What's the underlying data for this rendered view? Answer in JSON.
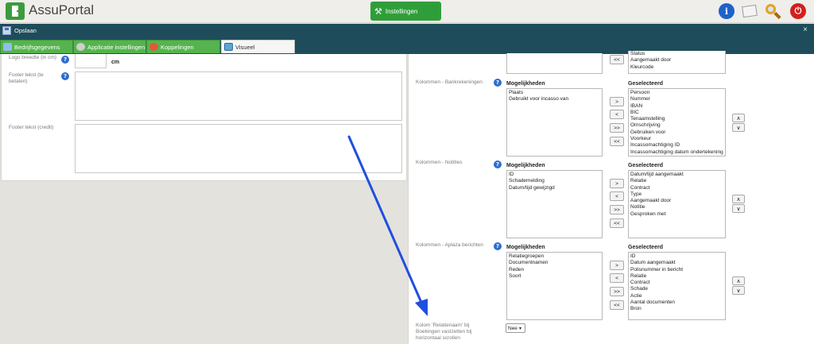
{
  "app": {
    "name": "AssuPortal"
  },
  "header": {
    "settings_label": "Instellingen",
    "info_icon": "info-icon",
    "messages_icon": "envelope-icon",
    "search_icon": "magnifier-icon",
    "power_icon": "power-icon"
  },
  "savebar": {
    "save_label": "Opslaan",
    "close": "×"
  },
  "tabs": [
    {
      "label": "Bedrijfsgegevens",
      "active": false
    },
    {
      "label": "Applicatie instellingen",
      "active": false
    },
    {
      "label": "Koppelingen",
      "active": false
    },
    {
      "label": "Visueel",
      "active": true
    }
  ],
  "left": {
    "logo_label": "Logo breedte (in cm)",
    "logo_unit": "cm",
    "footer_pay_label": "Footer tekst (te betalen)",
    "footer_credit_label": "Footer tekst (credit)"
  },
  "right": {
    "top_selected": [
      "Status",
      "Aangemaakt door",
      "Kleurcode"
    ],
    "sections": [
      {
        "label": "Kolommen - Bankrekeningen",
        "options_head": "Mogelijkheden",
        "selected_head": "Geselecteerd",
        "options": [
          "Plaats",
          "Gebruikt voor incasso van"
        ],
        "selected": [
          "Persoon",
          "Nummer",
          "IBAN",
          "BIC",
          "Tenaamstelling",
          "Omschrijving",
          "Gebruiken voor",
          "Voorkeur",
          "Incassomachtiging ID",
          "Incassomachtiging datum ondertekening"
        ]
      },
      {
        "label": "Kolommen - Notities",
        "options_head": "Mogelijkheden",
        "selected_head": "Geselecteerd",
        "options": [
          "ID",
          "Schademelding",
          "Datum/tijd gewijzigd"
        ],
        "selected": [
          "Datum/tijd aangemaakt",
          "Relatie",
          "Contract",
          "Type",
          "Aangemaakt door",
          "Notitie",
          "Gesproken met"
        ]
      },
      {
        "label": "Kolommen - Aplaza berichten",
        "options_head": "Mogelijkheden",
        "selected_head": "Geselecteerd",
        "options": [
          "Relatiegroepen",
          "Documentnamen",
          "Reden",
          "Soort"
        ],
        "selected": [
          "ID",
          "Datum aangemaakt",
          "Polisnummer in bericht",
          "Relatie",
          "Contract",
          "Schade",
          "Actie",
          "Aantal documenten",
          "Bron"
        ]
      }
    ],
    "move_buttons": [
      ">",
      "<",
      ">>",
      "<<"
    ],
    "order_buttons": [
      "∧",
      "∨"
    ],
    "freeze_label": "Kolom 'Relatienaam' bij Boekingen vastzetten bij horizontaal scrollen",
    "freeze_value": "Nee"
  }
}
